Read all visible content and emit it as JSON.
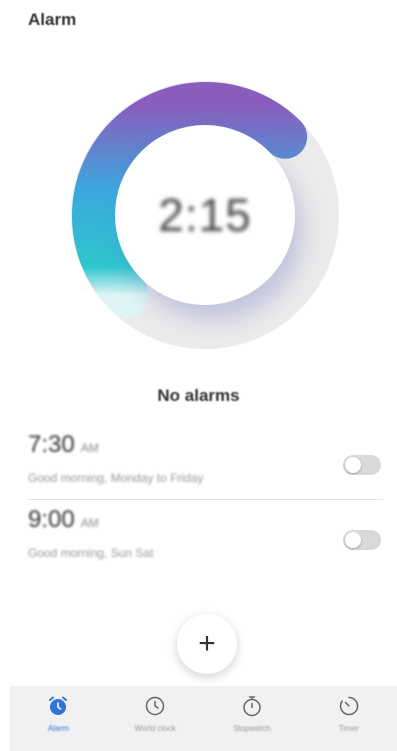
{
  "app": {
    "title": "Alarm"
  },
  "dial": {
    "time": "2:15",
    "colors": {
      "start": "#8a5cbd",
      "mid": "#3ba7dc",
      "end": "#2ec6cf",
      "track": "#ebebeb"
    }
  },
  "alarms": {
    "empty_title": "No alarms",
    "items": [
      {
        "time": "7:30",
        "ampm": "AM",
        "label": "Good morning, Monday to Friday",
        "enabled": false
      },
      {
        "time": "9:00",
        "ampm": "AM",
        "label": "Good morning, Sun Sat",
        "enabled": false
      }
    ]
  },
  "fab": {
    "icon": "+"
  },
  "nav": {
    "active_color": "#2f74d9",
    "items": [
      {
        "label": "Alarm",
        "icon": "alarm-clock-icon"
      },
      {
        "label": "World clock",
        "icon": "clock-icon"
      },
      {
        "label": "Stopwatch",
        "icon": "stopwatch-icon"
      },
      {
        "label": "Timer",
        "icon": "timer-icon"
      }
    ]
  }
}
